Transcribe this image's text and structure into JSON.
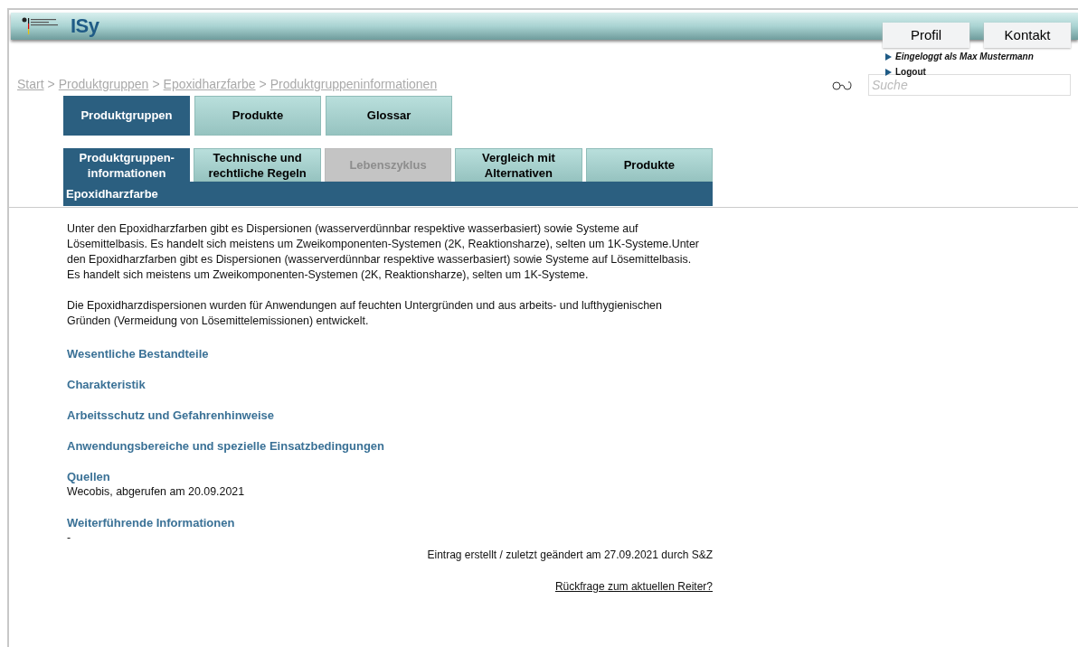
{
  "header": {
    "logo_text": "ISy",
    "buttons": [
      {
        "label": "Profil"
      },
      {
        "label": "Kontakt"
      }
    ]
  },
  "user_links": [
    {
      "label": "Eingeloggt als Max Mustermann",
      "italic": true
    },
    {
      "label": "Logout",
      "italic": false
    }
  ],
  "breadcrumb": {
    "separator": ">",
    "items": [
      "Start",
      "Produktgruppen",
      "Epoxidharzfarbe",
      "Produktgruppeninformationen"
    ]
  },
  "search": {
    "placeholder": "Suche"
  },
  "main_tabs": [
    {
      "label": "Produktgruppen",
      "selected": true
    },
    {
      "label": "Produkte",
      "selected": false
    },
    {
      "label": "Glossar",
      "selected": false
    }
  ],
  "sub_tabs": [
    {
      "label": "Produktgruppen-informationen",
      "selected": true,
      "disabled": false
    },
    {
      "label": "Technische und rechtliche Regeln",
      "selected": false,
      "disabled": false
    },
    {
      "label": "Lebenszyklus",
      "selected": false,
      "disabled": true
    },
    {
      "label": "Vergleich mit Alternativen",
      "selected": false,
      "disabled": false
    },
    {
      "label": "Produkte",
      "selected": false,
      "disabled": false
    }
  ],
  "section_title": "Epoxidharzfarbe",
  "paragraphs": [
    "Unter den Epoxidharzfarben gibt es Dispersionen (wasserverdünnbar respektive wasserbasiert) sowie Systeme auf Lösemittelbasis. Es handelt sich meistens um Zweikomponenten-Systemen (2K, Reaktionsharze), selten um 1K-Systeme.Unter den Epoxidharzfarben gibt es Dispersionen (wasserverdünnbar respektive wasserbasiert) sowie Systeme auf Lösemittelbasis. Es handelt sich meistens um Zweikomponenten-Systemen (2K, Reaktionsharze), selten um 1K-Systeme.",
    "Die Epoxidharzdispersionen wurden für Anwendungen auf feuchten Untergründen und aus arbeits- und lufthygienischen Gründen (Vermeidung von Lösemittelemissionen) entwickelt."
  ],
  "sections": [
    {
      "title": "Wesentliche Bestandteile"
    },
    {
      "title": "Charakteristik"
    },
    {
      "title": "Arbeitsschutz und Gefahrenhinweise"
    },
    {
      "title": "Anwendungsbereiche und spezielle Einsatzbedingungen"
    },
    {
      "title": "Quellen",
      "text": "Wecobis, abgerufen am 20.09.2021"
    },
    {
      "title": "Weiterführende Informationen",
      "text": "-"
    }
  ],
  "footer": {
    "note": "Eintrag erstellt / zuletzt geändert am 27.09.2021 durch S&Z",
    "link": "Rückfrage zum aktuellen Reiter?"
  }
}
